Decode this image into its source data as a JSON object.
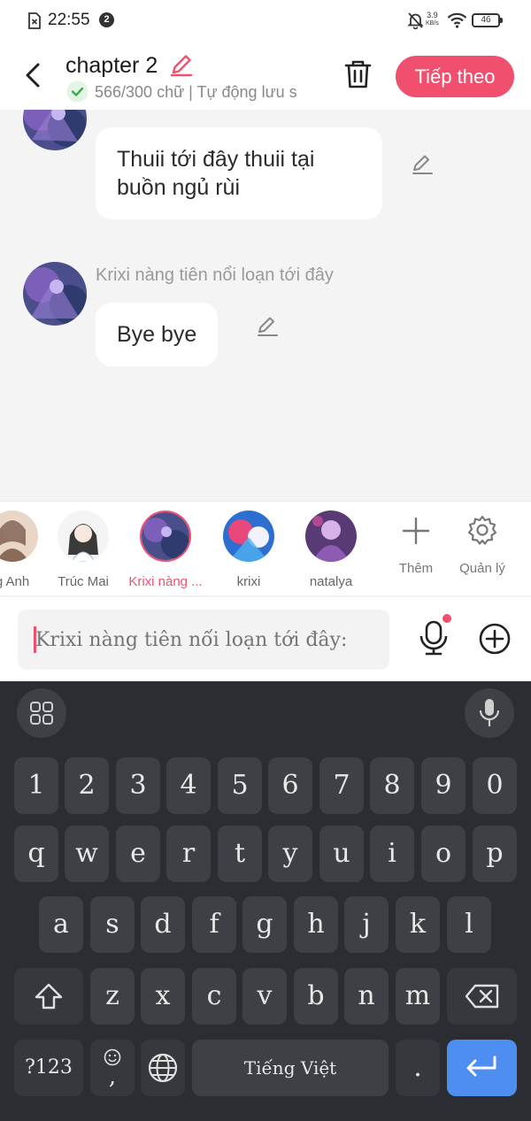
{
  "status_bar": {
    "time": "22:55",
    "notification_count": "2",
    "net_speed_value": "3.9",
    "net_speed_unit": "KB/s",
    "battery": "46"
  },
  "header": {
    "title": "chapter 2",
    "subtitle": "566/300 chữ | Tự động lưu s",
    "next_label": "Tiếp theo",
    "accent_color": "#f0506e"
  },
  "messages": [
    {
      "text": "Thuii tới đây thuii tại buồn ngủ rùi"
    },
    {
      "sender": "Krixi nàng tiên nổi loạn tới đây",
      "text": "Bye bye"
    }
  ],
  "characters": [
    {
      "name": "g Anh"
    },
    {
      "name": "Trúc Mai"
    },
    {
      "name": "Krixi nàng ...",
      "active": true
    },
    {
      "name": "krixi"
    },
    {
      "name": "natalya"
    }
  ],
  "tools": {
    "add_label": "Thêm",
    "manage_label": "Quản lý"
  },
  "input": {
    "placeholder": "Krixi nàng tiên nổi loạn tới đây:"
  },
  "keyboard": {
    "numbers": [
      "1",
      "2",
      "3",
      "4",
      "5",
      "6",
      "7",
      "8",
      "9",
      "0"
    ],
    "row1": [
      "q",
      "w",
      "e",
      "r",
      "t",
      "y",
      "u",
      "i",
      "o",
      "p"
    ],
    "row2": [
      "a",
      "s",
      "d",
      "f",
      "g",
      "h",
      "j",
      "k",
      "l"
    ],
    "row3": [
      "z",
      "x",
      "c",
      "v",
      "b",
      "n",
      "m"
    ],
    "symbols_label": "?123",
    "comma": ",",
    "space_label": "Tiếng Việt",
    "period": "."
  }
}
